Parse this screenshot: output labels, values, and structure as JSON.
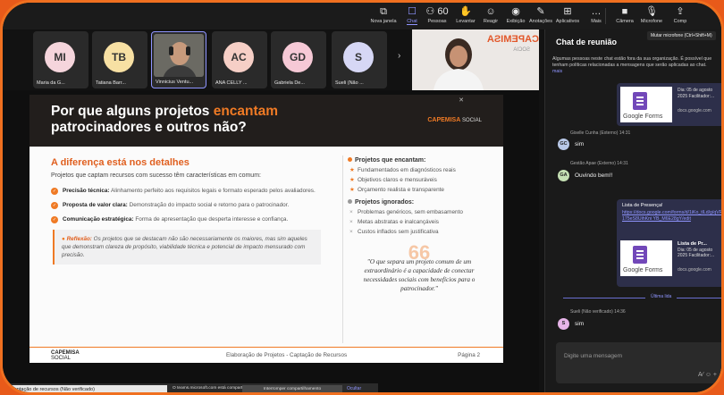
{
  "toolbar": {
    "items": [
      {
        "icon": "new-window-icon",
        "glyph": "⧉",
        "label": "Nova janela"
      },
      {
        "icon": "chat-icon",
        "glyph": "☐",
        "label": "Chat"
      },
      {
        "icon": "people-icon",
        "glyph": "⚇",
        "label": "Pessoas",
        "count": "60"
      },
      {
        "icon": "raise-hand-icon",
        "glyph": "✋",
        "label": "Levantar"
      },
      {
        "icon": "react-icon",
        "glyph": "☺",
        "label": "Reagir"
      },
      {
        "icon": "view-icon",
        "glyph": "◉",
        "label": "Exibição"
      },
      {
        "icon": "notes-icon",
        "glyph": "✎",
        "label": "Anotações"
      },
      {
        "icon": "apps-icon",
        "glyph": "⊞",
        "label": "Aplicativos"
      },
      {
        "icon": "more-icon",
        "glyph": "…",
        "label": "Mais"
      },
      {
        "icon": "camera-icon",
        "glyph": "■",
        "label": "Câmera"
      },
      {
        "icon": "mic-icon",
        "glyph": "🎙",
        "label": "Microfone"
      },
      {
        "icon": "share-icon",
        "glyph": "⇪",
        "label": "Comp"
      }
    ]
  },
  "participants": [
    {
      "initials": "MI",
      "name": "Maria da G...",
      "color": "#f5d5dc"
    },
    {
      "initials": "TB",
      "name": "Tatiana Barr...",
      "color": "#f7e0a3"
    },
    {
      "initials": "",
      "name": "Vinnicius Ventu...",
      "color": "#5a5a55"
    },
    {
      "initials": "AC",
      "name": "ANA CELLY ...",
      "color": "#f6cfc6"
    },
    {
      "initials": "GD",
      "name": "Gabriela De...",
      "color": "#f6c9d6"
    },
    {
      "initials": "S",
      "name": "Sueli (Não ...",
      "color": "#d6d7f5"
    }
  ],
  "presenter": {
    "brand_text": "CAPEMISA",
    "sub_text": "SOCIA"
  },
  "slide": {
    "title_pre": "Por que alguns projetos ",
    "title_accent": "encantam",
    "title_post": " patrocinadores e outros não?",
    "brand": "CAPEMISA",
    "brand_sub": "SOCIAL",
    "section_title": "A diferença está nos detalhes",
    "intro": "Projetos que captam recursos com sucesso têm características em comum:",
    "features": [
      {
        "title": "Precisão técnica:",
        "text": " Alinhamento perfeito aos requisitos legais e formato esperado pelos avaliadores."
      },
      {
        "title": "Proposta de valor clara:",
        "text": " Demonstração do impacto social e retorno para o patrocinador."
      },
      {
        "title": "Comunicação estratégica:",
        "text": " Forma de apresentação que desperta interesse e confiança."
      }
    ],
    "reflection_label": "Reflexão:",
    "reflection_text": " Os projetos que se destacam não são necessariamente os maiores, mas sim aqueles que demonstram clareza de propósito, viabilidade técnica e potencial de impacto mensurado com precisão.",
    "enchant_title": "Projetos que encantam:",
    "enchant_items": [
      "Fundamentados em diagnósticos reais",
      "Objetivos claros e mensuráveis",
      "Orçamento realista e transparente"
    ],
    "ignored_title": "Projetos ignorados:",
    "ignored_items": [
      "Problemas genéricos, sem embasamento",
      "Metas abstratas e inalcançáveis",
      "Custos inflados sem justificativa"
    ],
    "quote_mark": "66",
    "quote": "\"O que separa um projeto comum de um extraordinário é a capacidade de conectar necessidades sociais com benefícios para o patrocinador.\"",
    "footer_brand": "CAPEMISA",
    "footer_brand_sub": "SOCIAL",
    "footer_center": "Elaboração de Projetos - Captação de Recursos",
    "footer_page": "Página 2"
  },
  "notice": {
    "left": "captação de recursos (Não verificado)",
    "text": "O teams.microsoft.com está compartilhando sua tela.",
    "stop": "Interromper compartilhamento",
    "hide": "Ocultar"
  },
  "chat": {
    "title": "Chat de reunião",
    "tooltip": "Mutar microfone (Ctrl+Shift+M)",
    "info": "Algumas pessoas neste chat estão fora da sua organização. É possível que tenham políticas relacionadas a mensagens que serão aplicadas ao chat.",
    "info_more": "mais",
    "card1": {
      "title": "Lista de Pr...",
      "date": "Dia: 05 de agosto",
      "line": "2025 Facilitador:...",
      "domain": "docs.google.com",
      "forms": "Google Forms"
    },
    "msg1": {
      "sender": "Giselle Cunha (Externo)  14:31",
      "initials": "GC",
      "text": "sim",
      "color": "#b9c9e8"
    },
    "msg2": {
      "sender": "Gestão Apae (Externo)  14:31",
      "initials": "GA",
      "text": "Ouvindo bem!!",
      "color": "#c5e0b4"
    },
    "card2": {
      "label": "Lista de Presença!",
      "link": "https://docs.google.com/forms/d/1iKo_tlLd/g/qVFf175eS8UihKni YB_M6E28gY/edit",
      "title": "Lista de Pr...",
      "date": "Dia: 05 de agosto",
      "line": "2025 Facilitador:...",
      "domain": "docs.google.com",
      "forms": "Google Forms"
    },
    "last_read": "Última lida",
    "msg3": {
      "sender": "Sueli (Não verificado)  14:36",
      "initials": "S",
      "text": "sim",
      "color": "#e6b4e8"
    },
    "compose_placeholder": "Digite uma mensagem",
    "compose_icons": "A⁄  ☺  +"
  }
}
